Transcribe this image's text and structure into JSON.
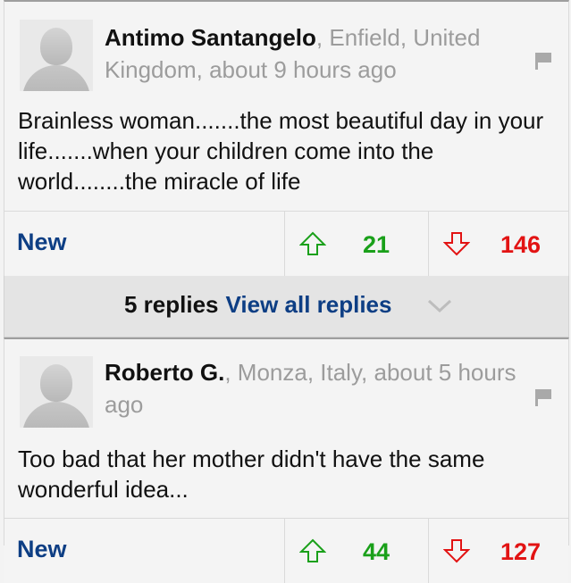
{
  "comments": [
    {
      "author": "Antimo Santangelo",
      "meta": ", Enfield, United Kingdom, about 9 hours ago",
      "text": "Brainless woman.......the most beautiful day in your life.......when your children come into the world........the miracle of life",
      "new_label": "New",
      "upvotes": "21",
      "downvotes": "146"
    },
    {
      "author": "Roberto G.",
      "meta": ", Monza, Italy, about 5 hours ago",
      "text": "Too bad that her mother didn't have the same wonderful idea...",
      "new_label": "New",
      "upvotes": "44",
      "downvotes": "127"
    }
  ],
  "replies": {
    "count_label": "5 replies",
    "view_all_label": "View all replies"
  },
  "icons": {
    "avatar": "default-avatar-icon",
    "flag": "flag-icon",
    "upvote": "arrow-up-icon",
    "downvote": "arrow-down-icon",
    "expand": "chevron-down-icon"
  },
  "colors": {
    "link": "#0d3e84",
    "upvote": "#1aa01a",
    "downvote": "#e21313"
  }
}
